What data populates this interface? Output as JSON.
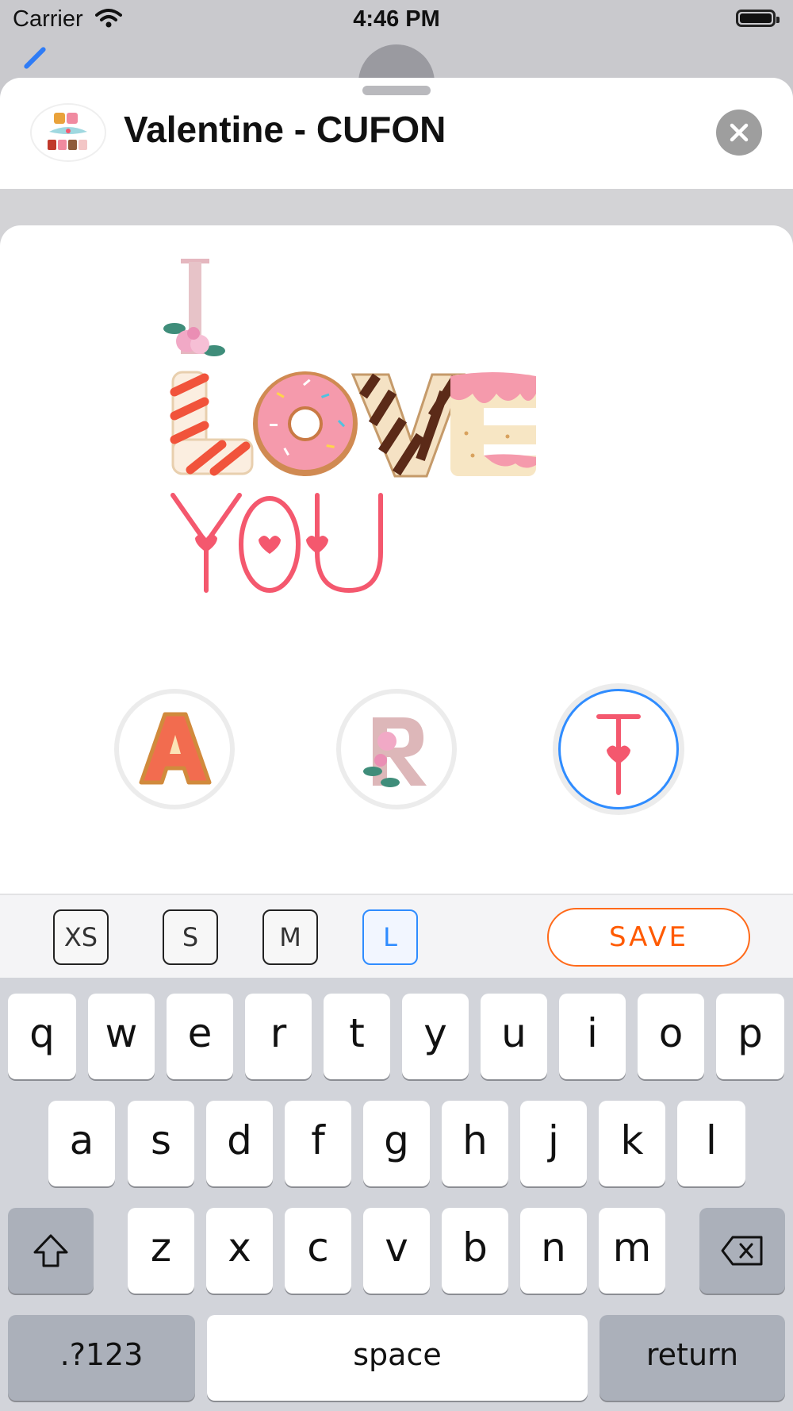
{
  "status_bar": {
    "carrier": "Carrier",
    "time": "4:46 PM"
  },
  "header": {
    "title": "Valentine - CUFON",
    "icon": "be-mine-app-icon"
  },
  "preview": {
    "lines": [
      "I",
      "LOVE",
      "YOU"
    ]
  },
  "font_choices": [
    {
      "glyph": "A",
      "style": "cookie",
      "selected": false
    },
    {
      "glyph": "R",
      "style": "floral",
      "selected": false
    },
    {
      "glyph": "T",
      "style": "heart-line",
      "selected": true
    }
  ],
  "toolbar": {
    "sizes": [
      "XS",
      "S",
      "M",
      "L"
    ],
    "active_size": "L",
    "save_label": "SAVE"
  },
  "keyboard": {
    "row1": [
      "q",
      "w",
      "e",
      "r",
      "t",
      "y",
      "u",
      "i",
      "o",
      "p"
    ],
    "row2": [
      "a",
      "s",
      "d",
      "f",
      "g",
      "h",
      "j",
      "k",
      "l"
    ],
    "row3": [
      "z",
      "x",
      "c",
      "v",
      "b",
      "n",
      "m"
    ],
    "numbers_label": ".?123",
    "space_label": "space",
    "return_label": "return"
  },
  "colors": {
    "accent_blue": "#2f8cff",
    "save_orange": "#ff5a00",
    "heart_pink": "#f4586e"
  }
}
